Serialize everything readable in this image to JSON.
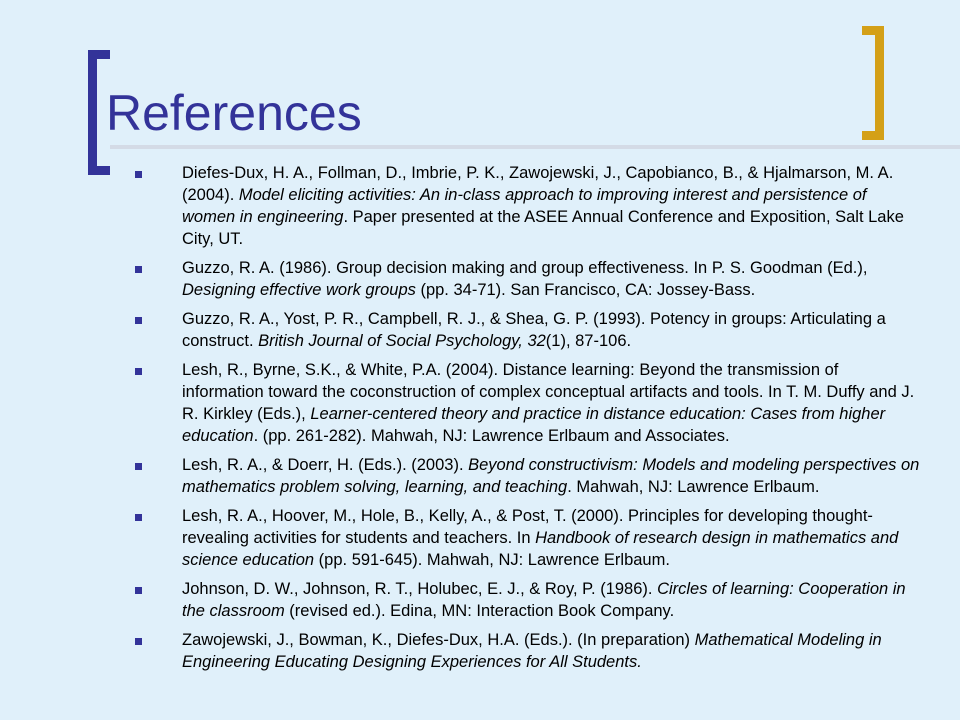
{
  "slide": {
    "title": "References",
    "references": [
      {
        "segments": [
          {
            "text": "Diefes-Dux, H. A., Follman, D., Imbrie, P. K., Zawojewski, J., Capobianco, B., & Hjalmarson, M. A. (2004). ",
            "italic": false
          },
          {
            "text": "Model eliciting activities: An in-class approach to improving interest and persistence of women in engineering",
            "italic": true
          },
          {
            "text": ". Paper presented at the ASEE Annual Conference and Exposition, Salt Lake City, UT.",
            "italic": false
          }
        ]
      },
      {
        "segments": [
          {
            "text": "Guzzo, R. A. (1986). Group decision making and group effectiveness. In P. S. Goodman (Ed.), ",
            "italic": false
          },
          {
            "text": "Designing effective work groups",
            "italic": true
          },
          {
            "text": " (pp. 34-71). San Francisco, CA: Jossey-Bass.",
            "italic": false
          }
        ]
      },
      {
        "segments": [
          {
            "text": "Guzzo, R. A., Yost, P. R., Campbell, R. J., & Shea, G. P. (1993). Potency in groups: Articulating a construct. ",
            "italic": false
          },
          {
            "text": "British Journal of Social Psychology, 32",
            "italic": true
          },
          {
            "text": "(1), 87-106.",
            "italic": false
          }
        ]
      },
      {
        "segments": [
          {
            "text": "Lesh, R., Byrne, S.K., & White, P.A. (2004). Distance learning: Beyond the transmission of information toward the coconstruction of complex conceptual artifacts and tools. In T. M. Duffy and J. R. Kirkley (Eds.), ",
            "italic": false
          },
          {
            "text": "Learner-centered theory and practice in distance education: Cases from higher education",
            "italic": true
          },
          {
            "text": ". (pp. 261-282). Mahwah, NJ: Lawrence Erlbaum and Associates.",
            "italic": false
          }
        ]
      },
      {
        "segments": [
          {
            "text": "Lesh, R. A., & Doerr, H. (Eds.). (2003). ",
            "italic": false
          },
          {
            "text": "Beyond constructivism: Models and modeling perspectives on mathematics problem solving, learning, and teaching",
            "italic": true
          },
          {
            "text": ". Mahwah, NJ: Lawrence Erlbaum.",
            "italic": false
          }
        ]
      },
      {
        "segments": [
          {
            "text": "Lesh, R. A., Hoover, M., Hole, B., Kelly, A., & Post, T. (2000). Principles for developing thought-revealing activities for students and teachers. In ",
            "italic": false
          },
          {
            "text": "Handbook of research design in mathematics and science education",
            "italic": true
          },
          {
            "text": " (pp. 591-645). Mahwah, NJ: Lawrence Erlbaum.",
            "italic": false
          }
        ]
      },
      {
        "segments": [
          {
            "text": "Johnson, D. W., Johnson, R. T., Holubec, E. J., & Roy, P. (1986). ",
            "italic": false
          },
          {
            "text": "Circles of learning: Cooperation in the classroom",
            "italic": true
          },
          {
            "text": " (revised ed.). Edina, MN: Interaction Book Company.",
            "italic": false
          }
        ]
      },
      {
        "segments": [
          {
            "text": "Zawojewski, J., Bowman, K., Diefes-Dux, H.A. (Eds.). (In preparation) ",
            "italic": false
          },
          {
            "text": "Mathematical Modeling in Engineering Educating Designing Experiences for All Students.",
            "italic": true
          }
        ]
      }
    ]
  },
  "colors": {
    "background": "#e0f0fa",
    "title": "#333399",
    "left_bracket": "#333399",
    "right_bracket": "#d4a017",
    "bullet": "#333399"
  }
}
